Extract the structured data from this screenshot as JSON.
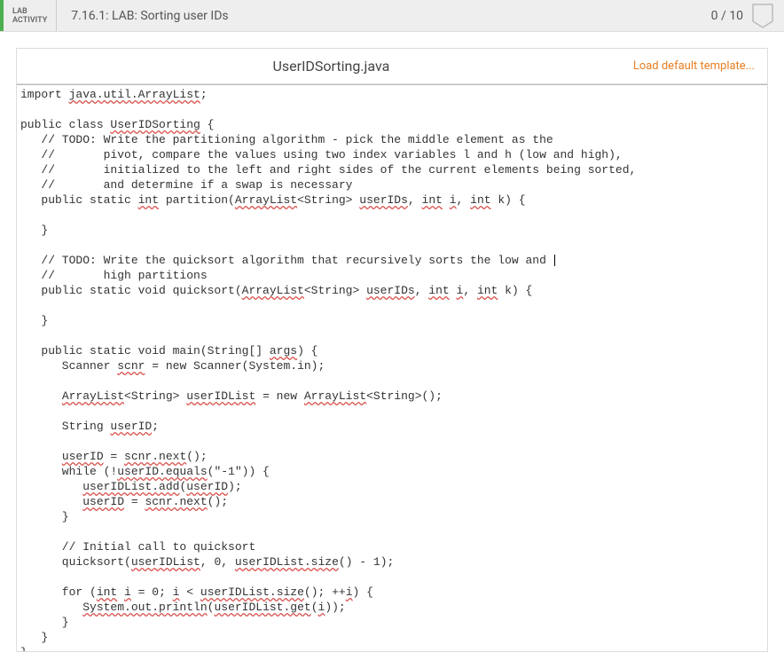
{
  "header": {
    "activity_label_line1": "LAB",
    "activity_label_line2": "ACTIVITY",
    "title": "7.16.1: LAB: Sorting user IDs",
    "score": "0 / 10"
  },
  "editor": {
    "filename": "UserIDSorting.java",
    "load_default": "Load default template..."
  },
  "code": {
    "l01a": "import ",
    "l01b": "java.util.ArrayList",
    "l01c": ";",
    "l02": "",
    "l03a": "public class ",
    "l03b": "UserIDSorting",
    "l03c": " {",
    "l04": "   // TODO: Write the partitioning algorithm - pick the middle element as the ",
    "l05": "   //       pivot, compare the values using two index variables l and h (low and high), ",
    "l06": "   //       initialized to the left and right sides of the current elements being sorted,",
    "l07": "   //       and determine if a swap is necessary",
    "l08a": "   public static ",
    "l08b": "int",
    "l08c": " partition(",
    "l08d": "ArrayList",
    "l08e": "<String> ",
    "l08f": "userIDs",
    "l08g": ", ",
    "l08h": "int",
    "l08i": " ",
    "l08j": "i",
    "l08k": ", ",
    "l08l": "int",
    "l08m": " k) {",
    "l09": "      ",
    "l10": "   }",
    "l11": "",
    "l12": "   // TODO: Write the quicksort algorithm that recursively sorts the low and ",
    "l13": "   //       high partitions",
    "l14a": "   public static void quicksort(",
    "l14b": "ArrayList",
    "l14c": "<String> ",
    "l14d": "userIDs",
    "l14e": ", ",
    "l14f": "int",
    "l14g": " ",
    "l14h": "i",
    "l14i": ", ",
    "l14j": "int",
    "l14k": " k) {",
    "l15": "      ",
    "l16": "   }",
    "l17": "",
    "l18a": "   public static void main(String[] ",
    "l18b": "args",
    "l18c": ") {",
    "l19a": "      Scanner ",
    "l19b": "scnr",
    "l19c": " = new Scanner(System.in);",
    "l20": "",
    "l21a": "      ",
    "l21b": "ArrayList",
    "l21c": "<String> ",
    "l21d": "userIDList",
    "l21e": " = new ",
    "l21f": "ArrayList",
    "l21g": "<String>();",
    "l22": "",
    "l23a": "      String ",
    "l23b": "userID",
    "l23c": ";",
    "l24": "",
    "l25a": "      ",
    "l25b": "userID",
    "l25c": " = ",
    "l25d": "scnr.next",
    "l25e": "();",
    "l26a": "      while (!",
    "l26b": "userID.equals",
    "l26c": "(\"-1\")) {",
    "l27a": "         ",
    "l27b": "userIDList.add",
    "l27c": "(",
    "l27d": "userID",
    "l27e": ");",
    "l28a": "         ",
    "l28b": "userID",
    "l28c": " = ",
    "l28d": "scnr.next",
    "l28e": "();",
    "l29": "      }",
    "l30": "      ",
    "l31": "      // Initial call to quicksort",
    "l32a": "      quicksort(",
    "l32b": "userIDList",
    "l32c": ", 0, ",
    "l32d": "userIDList.size",
    "l32e": "() - 1);",
    "l33": "",
    "l34a": "      for (",
    "l34b": "int",
    "l34c": " ",
    "l34d": "i",
    "l34e": " = 0; ",
    "l34f": "i",
    "l34g": " < ",
    "l34h": "userIDList.size",
    "l34i": "(); ++",
    "l34j": "i",
    "l34k": ") {",
    "l35a": "         ",
    "l35b": "System.out.println",
    "l35c": "(",
    "l35d": "userIDList.get",
    "l35e": "(",
    "l35f": "i",
    "l35g": "));",
    "l36": "      }",
    "l37": "   }",
    "l38": "}"
  }
}
